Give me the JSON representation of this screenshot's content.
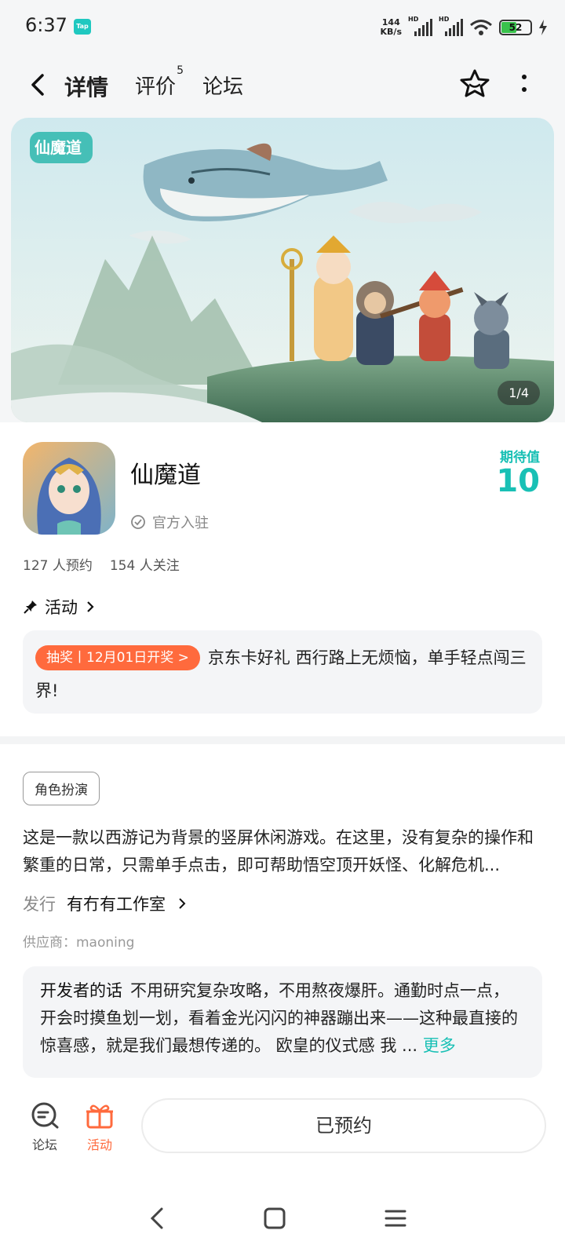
{
  "status_bar": {
    "time": "6:37",
    "tap_badge": "Tap",
    "net_speed_value": "144",
    "net_speed_unit": "KB/s",
    "signal_label": "HD",
    "battery": "52",
    "battery_fraction": 0.52
  },
  "nav": {
    "tabs": [
      {
        "label": "详情",
        "active": true
      },
      {
        "label": "评价",
        "badge": "5"
      },
      {
        "label": "论坛"
      }
    ]
  },
  "banner": {
    "logo_text": "仙魔道",
    "counter": "1/4"
  },
  "app": {
    "name": "仙魔道",
    "official_label": "官方入驻",
    "expectation_label": "期待值",
    "expectation_value": "10",
    "reservations": "127 人预约",
    "followers": "154 人关注"
  },
  "activity": {
    "section_label": "活动",
    "tag": "抽奖丨12月01日开奖 >",
    "text": "京东卡好礼 西行路上无烦恼，单手轻点闯三界!"
  },
  "details": {
    "genre_tag": "角色扮演",
    "description": "这是一款以西游记为背景的竖屏休闲游戏。在这里，没有复杂的操作和繁重的日常，只需单手点击，即可帮助悟空顶开妖怪、化解危机...",
    "publisher_label": "发行",
    "publisher_value": "有冇有工作室",
    "supplier": "供应商：maoning",
    "developer_title": "开发者的话",
    "developer_text": "不用研究复杂攻略，不用熬夜爆肝。通勤时点一点，开会时摸鱼划一划，看着金光闪闪的神器蹦出来——这种最直接的惊喜感，就是我们最想传递的。 欧皇的仪式感 我 ...",
    "more": "更多"
  },
  "bottom_bar": {
    "forum_label": "论坛",
    "activity_label": "活动",
    "reserve_button": "已预约"
  },
  "colors": {
    "accent": "#19c0b5",
    "orange": "#ff6a3d",
    "status_bg": "#f5f6f7"
  }
}
